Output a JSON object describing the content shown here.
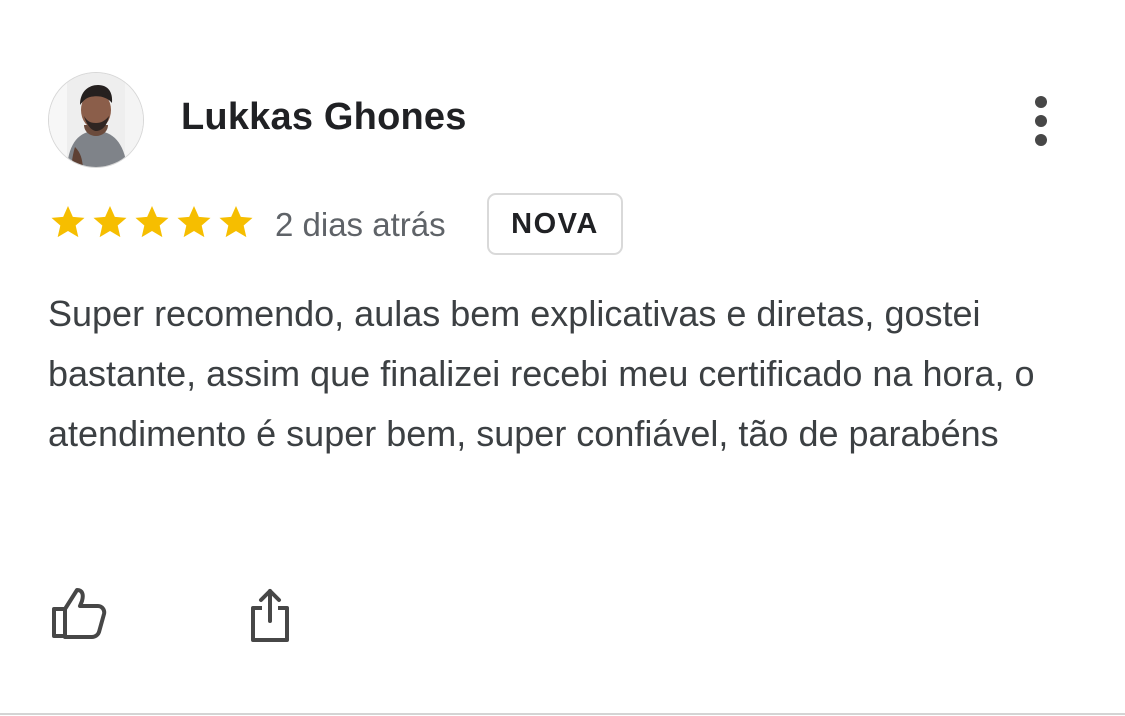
{
  "review": {
    "author": "Lukkas Ghones",
    "rating": 5,
    "max_rating": 5,
    "date": "2 dias atrás",
    "badge": "NOVA",
    "text": "Super recomendo, aulas bem explicativas e diretas, gostei bastante, assim que finalizei recebi meu certificado na hora, o atendimento é super bem, super confiável, tão de parabéns"
  },
  "colors": {
    "star": "#f6be00",
    "icon": "#474747",
    "text": "#3c4043",
    "secondary_text": "#5f6368",
    "divider": "#d4d4d4"
  },
  "icons": {
    "more": "more-vert-icon",
    "like": "thumbs-up-icon",
    "share": "share-icon"
  }
}
